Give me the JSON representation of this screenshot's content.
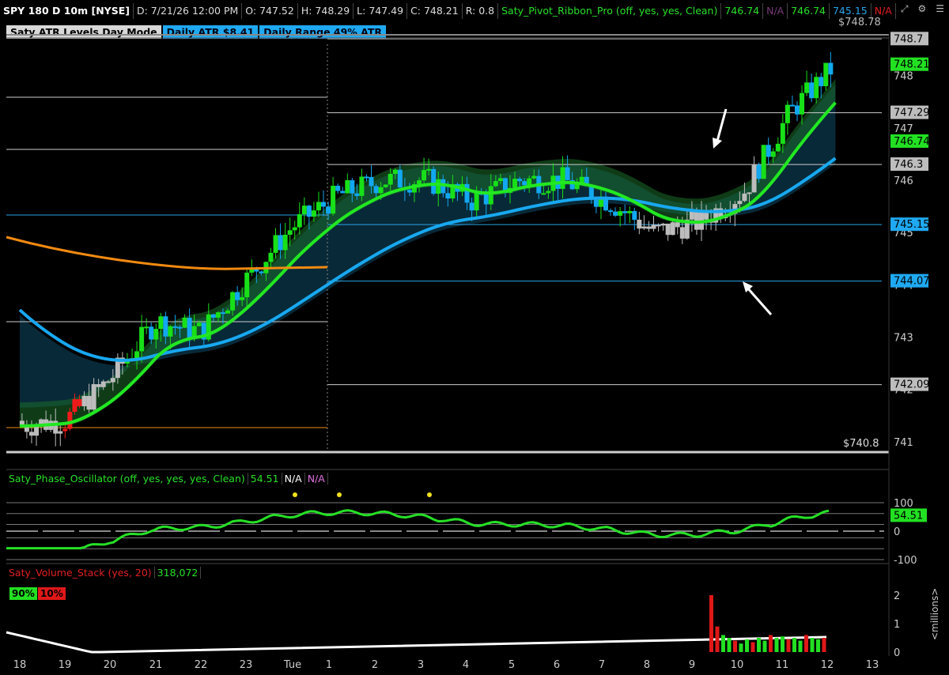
{
  "header": {
    "symbol": "SPY 180 D 10m [NYSE]",
    "date": "D: 7/21/26 12:00 PM",
    "open": "O: 747.52",
    "high": "H: 748.29",
    "low": "L: 747.49",
    "close": "C: 748.21",
    "range": "R: 0.8",
    "study": "Saty_Pivot_Ribbon_Pro (off, yes, yes, Clean)",
    "study_values": [
      "746.74",
      "N/A",
      "746.74",
      "745.15",
      "N/A"
    ],
    "icons": [
      "expand-icon",
      "settings-icon",
      "menu-icon"
    ]
  },
  "badges": {
    "atr_mode": "Saty ATR Levels Day Mode",
    "daily_atr": "Daily ATR $8.41",
    "daily_range": "Daily Range 49% ATR"
  },
  "oscillator": {
    "title": "Saty_Phase_Oscillator (off, yes, yes, yes, Clean)",
    "value": "54.51",
    "na1": "N/A",
    "na2": "N/A",
    "axis_labels": [
      "100",
      "0",
      "-100"
    ],
    "current_label": "54.51"
  },
  "volume": {
    "title": "Saty_Volume_Stack (yes, 20)",
    "value": "318,072",
    "buy_pct": "90%",
    "sell_pct": "10%",
    "axis_labels": [
      "2",
      "1",
      "0"
    ],
    "unit_label": "<millions>"
  },
  "price_axis": {
    "ticks": [
      "748",
      "747",
      "746",
      "745",
      "744",
      "743",
      "742",
      "741"
    ],
    "level_labels": [
      {
        "text": "748.7",
        "style": "grey"
      },
      {
        "text": "748.21",
        "style": "green"
      },
      {
        "text": "747.29",
        "style": "grey"
      },
      {
        "text": "746.74",
        "style": "green"
      },
      {
        "text": "746.3",
        "style": "grey"
      },
      {
        "text": "745.15",
        "style": "blue"
      },
      {
        "text": "744.07",
        "style": "blue"
      },
      {
        "text": "742.09",
        "style": "grey"
      }
    ],
    "top_label": "$748.78",
    "low_label": "$740.8"
  },
  "time_axis": [
    "18",
    "19",
    "20",
    "21",
    "22",
    "23",
    "Tue",
    "1",
    "2",
    "3",
    "4",
    "5",
    "6",
    "7",
    "8",
    "9",
    "10",
    "11",
    "12",
    "13"
  ],
  "chart_data": {
    "type": "candlestick",
    "title": "SPY 180 D 10m [NYSE]",
    "ylim": [
      740.8,
      748.78
    ],
    "x": [
      "18",
      "19",
      "20",
      "21",
      "22",
      "23",
      "Tue",
      "1",
      "2",
      "3",
      "4",
      "5",
      "6",
      "7",
      "8",
      "9",
      "10",
      "11",
      "12"
    ],
    "ohlc_close_hourly": [
      741.3,
      741.4,
      742.2,
      743.3,
      743.1,
      744.1,
      745.1,
      745.7,
      746.0,
      746.0,
      745.6,
      746.0,
      746.0,
      745.6,
      745.0,
      745.2,
      745.8,
      747.3,
      748.21
    ],
    "levels": [
      {
        "label": "748.7",
        "value": 748.7
      },
      {
        "label": "747.29",
        "value": 747.29
      },
      {
        "label": "746.3",
        "value": 746.3
      },
      {
        "label": "745.15",
        "value": 745.15
      },
      {
        "label": "744.07",
        "value": 744.07
      },
      {
        "label": "742.09",
        "value": 742.09
      }
    ],
    "series": [
      {
        "name": "Saty_Pivot_Ribbon_Pro",
        "last": 746.74
      },
      {
        "name": "Saty_Phase_Oscillator",
        "last": 54.51
      },
      {
        "name": "Saty_Volume_Stack",
        "last": 318072
      }
    ],
    "colors": {
      "bull": "#18e018",
      "bear_blue": "#12a8f0",
      "neutral": "#bdbdbd",
      "ema_fast": "#22e822",
      "ema_slow": "#18a8f0",
      "ema_red": "#ee1b1b",
      "ema_orange": "#f28a10"
    }
  }
}
